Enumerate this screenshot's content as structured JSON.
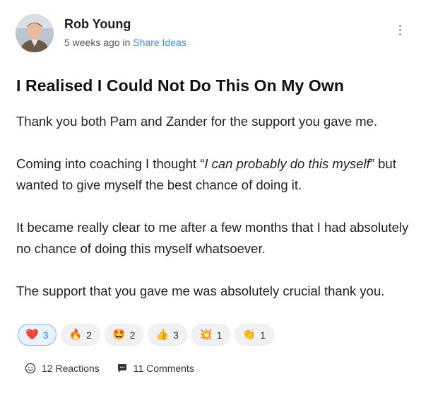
{
  "post": {
    "author": "Rob Young",
    "time": "5 weeks ago",
    "in_label": "in",
    "group": "Share Ideas",
    "title": "I Realised I Could Not Do This On My Own",
    "paragraphs": {
      "p1": "Thank you both Pam and Zander for the support you gave me.",
      "p2_before": "Coming into coaching I thought “",
      "p2_italic": "I can probably do this myself",
      "p2_after": "” but wanted to give myself the best chance of doing it.",
      "p3": "It became really clear to me after a few months that I had absolutely no chance of doing this myself whatsoever.",
      "p4": "The support that you gave me was absolutely crucial thank you."
    }
  },
  "reactions": [
    {
      "icon": "heart-icon",
      "glyph": "❤️",
      "count": "3",
      "active": true
    },
    {
      "icon": "fire-icon",
      "glyph": "🔥",
      "count": "2",
      "active": false
    },
    {
      "icon": "star-struck-icon",
      "glyph": "🤩",
      "count": "2",
      "active": false
    },
    {
      "icon": "thumbs-up-icon",
      "glyph": "👍",
      "count": "3",
      "active": false
    },
    {
      "icon": "sparkle-icon",
      "glyph": "💥",
      "count": "1",
      "active": false
    },
    {
      "icon": "clap-icon",
      "glyph": "👏",
      "count": "1",
      "active": false
    }
  ],
  "footer": {
    "reactions_label": "12 Reactions",
    "comments_label": "11 Comments"
  },
  "colors": {
    "accent": "#3b8bd9",
    "active_chip_bg": "#e8f2fc",
    "active_chip_border": "#7fb5ea"
  }
}
